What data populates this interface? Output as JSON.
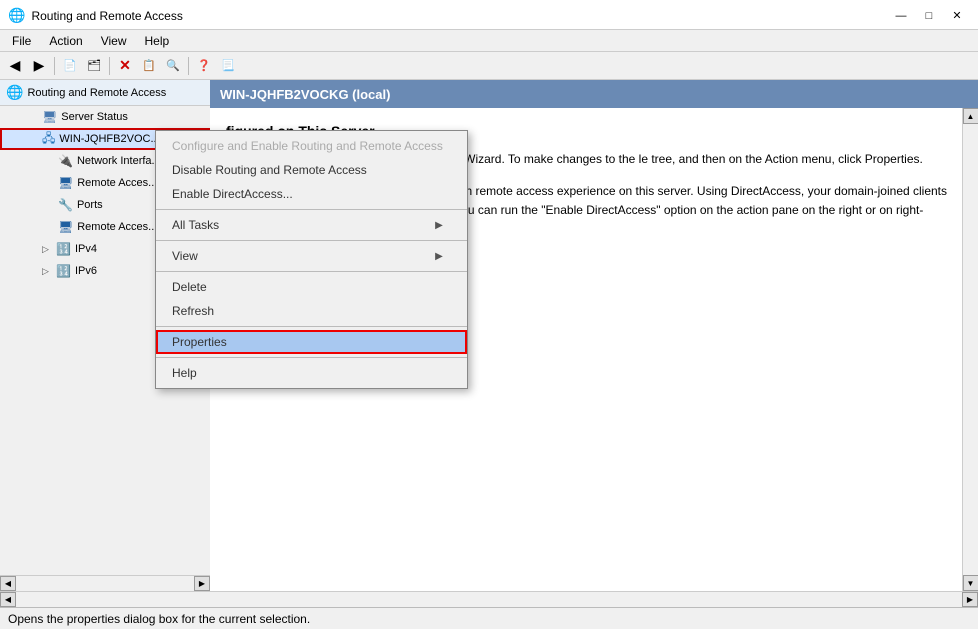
{
  "window": {
    "title": "Routing and Remote Access",
    "icon": "network-icon"
  },
  "titlebar": {
    "controls": {
      "minimize": "—",
      "maximize": "□",
      "close": "✕"
    }
  },
  "menubar": {
    "items": [
      "File",
      "Action",
      "View",
      "Help"
    ]
  },
  "toolbar": {
    "buttons": [
      "◀",
      "▶",
      "📄",
      "🗂",
      "✕",
      "📋",
      "🔍",
      "❓",
      "📃"
    ]
  },
  "tree": {
    "root_label": "Routing and Remote Access",
    "items": [
      {
        "id": "server-status",
        "label": "Server Status",
        "indent": 1,
        "icon": "server-status-icon"
      },
      {
        "id": "win-node",
        "label": "WIN-JQHFB2VOC...",
        "indent": 1,
        "icon": "server-icon",
        "selected": true,
        "highlighted": true
      },
      {
        "id": "network-interfaces",
        "label": "Network Interfa...",
        "indent": 2,
        "icon": "network-icon"
      },
      {
        "id": "remote-access-log",
        "label": "Remote Acces...",
        "indent": 2,
        "icon": "remote-icon"
      },
      {
        "id": "ports",
        "label": "Ports",
        "indent": 2,
        "icon": "ports-icon"
      },
      {
        "id": "remote-access-pol",
        "label": "Remote Acces...",
        "indent": 2,
        "icon": "policy-icon"
      },
      {
        "id": "ipv4",
        "label": "IPv4",
        "indent": 2,
        "icon": "ipv4-icon",
        "expandable": true
      },
      {
        "id": "ipv6",
        "label": "IPv6",
        "indent": 2,
        "icon": "ipv6-icon",
        "expandable": true
      }
    ]
  },
  "right_panel": {
    "header": "WIN-JQHFB2VOCKG (local)",
    "content_title": "figured on This Server",
    "content_body": "e Routing and Remote Access Server Setup Wizard. To make changes to the\nle tree, and then on the Action menu, click Properties.",
    "content_body2": "emote access to your clients. You can use rich remote access experience\non this server. Using DirectAccess, your domain-joined clients can\nTo enable DirectAccess on this server, you can run the \"Enable DirectAccess\"\noption on the action pane on the right or on right-clicking the machine node"
  },
  "context_menu": {
    "items": [
      {
        "id": "configure",
        "label": "Configure and Enable Routing and Remote Access",
        "disabled": true,
        "submenu": false
      },
      {
        "id": "disable",
        "label": "Disable Routing and Remote Access",
        "disabled": false,
        "submenu": false
      },
      {
        "id": "enable-directaccess",
        "label": "Enable DirectAccess...",
        "disabled": false,
        "submenu": false
      },
      {
        "id": "sep1",
        "separator": true
      },
      {
        "id": "all-tasks",
        "label": "All Tasks",
        "disabled": false,
        "submenu": true
      },
      {
        "id": "sep2",
        "separator": true
      },
      {
        "id": "view",
        "label": "View",
        "disabled": false,
        "submenu": true
      },
      {
        "id": "sep3",
        "separator": true
      },
      {
        "id": "delete",
        "label": "Delete",
        "disabled": false,
        "submenu": false
      },
      {
        "id": "refresh",
        "label": "Refresh",
        "disabled": false,
        "submenu": false
      },
      {
        "id": "sep4",
        "separator": true
      },
      {
        "id": "properties",
        "label": "Properties",
        "disabled": false,
        "submenu": false,
        "highlighted": true
      },
      {
        "id": "sep5",
        "separator": true
      },
      {
        "id": "help",
        "label": "Help",
        "disabled": false,
        "submenu": false
      }
    ]
  },
  "statusbar": {
    "text": "Opens the properties dialog box for the current selection."
  },
  "scrollbar": {
    "left_arrow": "◀",
    "right_arrow": "▶",
    "up_arrow": "▲",
    "down_arrow": "▼"
  }
}
